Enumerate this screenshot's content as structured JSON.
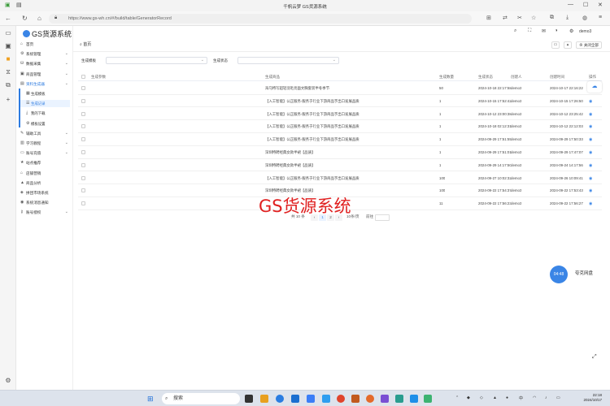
{
  "browser": {
    "window_title": "千帆云梦  GS货源系统",
    "url": "https://www.gs-wh.cn/#/build/table/GeneratorRecord",
    "back": "←",
    "refresh": "↻",
    "home": "⌂",
    "minimize": "—",
    "maximize": "☐",
    "close": "✕"
  },
  "app": {
    "logo_text": "GS货源系统",
    "user_name": "demo3"
  },
  "nav": [
    {
      "label": "首页",
      "icon": "home-icon",
      "expandable": false
    },
    {
      "label": "系统管理",
      "icon": "gear-icon",
      "expandable": true
    },
    {
      "label": "数据采集",
      "icon": "database-icon",
      "expandable": true
    },
    {
      "label": "商品管理",
      "icon": "box-icon",
      "expandable": true
    },
    {
      "label": "资料生成器",
      "icon": "document-icon",
      "expandable": true,
      "active": true
    }
  ],
  "subnav": [
    {
      "label": "生成模板",
      "icon": "template-icon"
    },
    {
      "label": "生成记录",
      "icon": "list-icon",
      "current": true
    },
    {
      "label": "我的下载",
      "icon": "download-icon"
    },
    {
      "label": "模板设置",
      "icon": "settings-icon"
    }
  ],
  "nav_rest": [
    {
      "label": "辅助工具",
      "icon": "tool-icon",
      "expandable": true
    },
    {
      "label": "学习教程",
      "icon": "book-icon",
      "expandable": true
    },
    {
      "label": "账号充值",
      "icon": "wallet-icon",
      "expandable": true
    },
    {
      "label": "站点推荐",
      "icon": "star-icon",
      "expandable": false
    },
    {
      "label": "店铺营销",
      "icon": "store-icon",
      "expandable": false
    },
    {
      "label": "商品分析",
      "icon": "chart-icon",
      "expandable": false
    },
    {
      "label": "拼团市场系统",
      "icon": "market-icon",
      "expandable": false
    },
    {
      "label": "系统消息通知",
      "icon": "bell-icon",
      "expandable": false
    },
    {
      "label": "账号授权",
      "icon": "key-icon",
      "expandable": true
    }
  ],
  "tabs": {
    "home_label": "首页",
    "close_all_label": "关闭全部"
  },
  "filters": {
    "template_label": "生成模板",
    "status_label": "生成状态"
  },
  "table": {
    "headers": [
      "生成参数",
      "生成商品",
      "生成数量",
      "生成状态",
      "创建人",
      "创建时间",
      "操作"
    ],
    "rows": [
      {
        "product": "海马特写超轻羽毛亮面文胸套装半冬季节",
        "qty": "50",
        "status": "2024-10-18 22:17:58",
        "user": "demo3",
        "time": "2024-10-17 22:16:22"
      },
      {
        "product": "【入工智能】公正服务-服务于行业下游商品字出口发展品质",
        "qty": "1",
        "status": "2024-10-15 17:52:42",
        "user": "demo3",
        "time": "2024-10-15 17:26:50"
      },
      {
        "product": "【入工智能】公正服务-服务于行业下游商品字出口发展品质",
        "qty": "1",
        "status": "2024-10-12 23:00:38",
        "user": "demo3",
        "time": "2024-10-12 23:25:42"
      },
      {
        "product": "【入工智能】公正服务-服务于行业下游商品字出口发展品质",
        "qty": "1",
        "status": "2024-10-18 02:12:31",
        "user": "demo3",
        "time": "2024-10-12 22:12:03"
      },
      {
        "product": "【入工智能】公正服务-服务于行业下游商品字出口发展品质",
        "qty": "1",
        "status": "2024-09-29 17:51:55",
        "user": "demo3",
        "time": "2024-09-29 17:50:33"
      },
      {
        "product": "深圳特聘经典女款半裙【品质】",
        "qty": "1",
        "status": "2024-09-29 17:51:01",
        "user": "demo3",
        "time": "2024-09-29 17:47:07"
      },
      {
        "product": "深圳特聘经典女款半裙【品质】",
        "qty": "1",
        "status": "2024-09-29 14:17:50",
        "user": "demo3",
        "time": "2024-09-24 14:17:56"
      },
      {
        "product": "【入工智能】公正服务-服务于行业下游商品字出口发展品质",
        "qty": "100",
        "status": "2024-09-27 10:02:32",
        "user": "demo3",
        "time": "2024-09-26 10:09:41"
      },
      {
        "product": "深圳特聘经典女款半裙【品质】",
        "qty": "100",
        "status": "2024-09-22 17:54:37",
        "user": "demo3",
        "time": "2024-09-22 17:53:43"
      },
      {
        "product": "",
        "qty": "11",
        "status": "2024-09-22 17:56:23",
        "user": "demo3",
        "time": "2024-09-22 17:56:27"
      }
    ],
    "action_icon": "◉"
  },
  "watermark": "GS货源系统",
  "pagination": {
    "total": "共 10 条",
    "prev": "‹",
    "page1": "1",
    "page2": "2",
    "next": "›",
    "page_size": "10条/页",
    "goto": "前往"
  },
  "float_widget": {
    "time": "04:48",
    "label": "夸克网盘"
  },
  "taskbar": {
    "search": "搜索",
    "time": "22:18",
    "date": "2024/10/17"
  }
}
